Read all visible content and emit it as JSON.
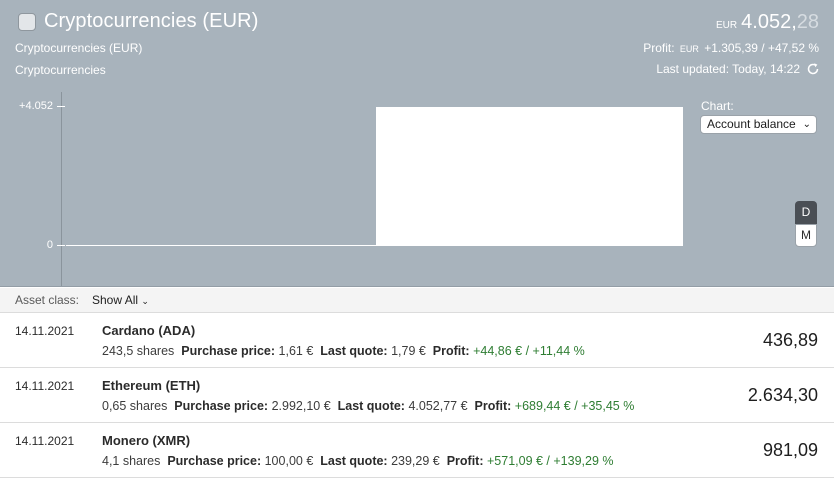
{
  "header": {
    "title": "Cryptocurrencies (EUR)",
    "subtitle1": "Cryptocurrencies (EUR)",
    "subtitle2": "Cryptocurrencies",
    "balance_currency": "EUR",
    "balance_integer": "4.052,",
    "balance_decimal": "28",
    "profit_label": "Profit:",
    "profit_currency": "EUR",
    "profit_value": "+1.305,39 / +47,52 %",
    "updated": "Last updated: Today, 14:22"
  },
  "chart": {
    "label": "Chart:",
    "select_value": "Account balance",
    "period_d": "D",
    "period_m": "M"
  },
  "chart_data": {
    "type": "area",
    "y_ticks": [
      "+4.052",
      "0"
    ],
    "ylim": [
      0,
      4052
    ],
    "values": [
      0,
      4052
    ],
    "grid": false
  },
  "filter": {
    "label": "Asset class:",
    "value": "Show All"
  },
  "assets": [
    {
      "date": "14.11.2021",
      "name": "Cardano (ADA)",
      "shares": "243,5 shares",
      "purchase_label": "Purchase price:",
      "purchase": "1,61 €",
      "quote_label": "Last quote:",
      "quote": "1,79 €",
      "profit_label": "Profit:",
      "profit": "+44,86 € / +11,44 %",
      "value": "436,89"
    },
    {
      "date": "14.11.2021",
      "name": "Ethereum (ETH)",
      "shares": "0,65 shares",
      "purchase_label": "Purchase price:",
      "purchase": "2.992,10 €",
      "quote_label": "Last quote:",
      "quote": "4.052,77 €",
      "profit_label": "Profit:",
      "profit": "+689,44 € / +35,45 %",
      "value": "2.634,30"
    },
    {
      "date": "14.11.2021",
      "name": "Monero (XMR)",
      "shares": "4,1 shares",
      "purchase_label": "Purchase price:",
      "purchase": "100,00 €",
      "quote_label": "Last quote:",
      "quote": "239,29 €",
      "profit_label": "Profit:",
      "profit": "+571,09 € / +139,29 %",
      "value": "981,09"
    }
  ]
}
